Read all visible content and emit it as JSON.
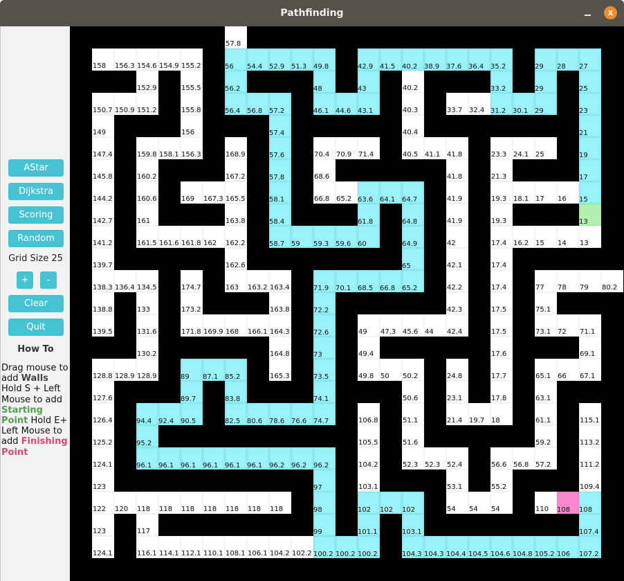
{
  "window": {
    "title": "Pathfinding",
    "minimize_label": "_",
    "close_label": "x"
  },
  "sidebar": {
    "buttons": {
      "astar": "AStar",
      "dijkstra": "Dijkstra",
      "scoring": "Scoring",
      "random": "Random",
      "plus": "+",
      "minus": "-",
      "clear": "Clear",
      "quit": "Quit"
    },
    "grid_size_label": "Grid Size 25",
    "howto_title": "How To",
    "howto": {
      "t1": "Drag mouse to add ",
      "walls": "Walls",
      "t2": " Hold S + Left Mouse to add ",
      "starting_point": "Starting Point",
      "t3": " Hold  E+ Left Mouse to add ",
      "finishing_point": "Finishing Point"
    }
  },
  "grid": {
    "size": 25,
    "legend": {
      "W": "wall",
      "o": "open",
      "p": "path",
      "s": "start",
      "e": "end"
    },
    "colors": {
      "wall": "#000000",
      "open": "#ffffff",
      "path": "#99f3f8",
      "start": "#b3efb0",
      "end": "#f888cf"
    },
    "rows": [
      [
        "W",
        "W",
        "W",
        "W",
        "W",
        "W",
        "W",
        "o:57.8",
        "W",
        "W",
        "W",
        "W",
        "W",
        "W",
        "W",
        "W",
        "W",
        "W",
        "W",
        "W",
        "W",
        "W",
        "W",
        "W",
        "W"
      ],
      [
        "W",
        "o:158",
        "o:156.3",
        "o:154.6",
        "o:154.9",
        "o:155.2",
        "W",
        "p:56",
        "p:54.4",
        "p:52.9",
        "p:51.3",
        "p:49.8",
        "W",
        "p:42.9",
        "p:41.5",
        "p:40.2",
        "p:38.9",
        "p:37.6",
        "p:36.4",
        "p:35.2",
        "W",
        "p:29",
        "p:28",
        "p:27",
        "W"
      ],
      [
        "W",
        "W",
        "W",
        "o:152.9",
        "W",
        "o:155.5",
        "W",
        "p:56.2",
        "W",
        "W",
        "W",
        "p:48",
        "W",
        "p:43",
        "W",
        "o:40.2",
        "W",
        "W",
        "W",
        "p:33.2",
        "W",
        "p:29",
        "W",
        "p:25",
        "W"
      ],
      [
        "W",
        "o:150.7",
        "o:150.9",
        "o:151.2",
        "W",
        "o:155.8",
        "W",
        "p:56.4",
        "p:56.8",
        "p:57.2",
        "W",
        "p:46.1",
        "p:44.6",
        "p:43.1",
        "W",
        "o:40.3",
        "W",
        "o:33.7",
        "o:32.4",
        "p:31.2",
        "p:30.1",
        "p:29",
        "W",
        "p:23",
        "W"
      ],
      [
        "W",
        "o:149",
        "W",
        "W",
        "W",
        "o:156",
        "W",
        "W",
        "W",
        "p:57.4",
        "W",
        "W",
        "W",
        "W",
        "W",
        "o:40.4",
        "W",
        "W",
        "W",
        "W",
        "W",
        "W",
        "W",
        "p:21",
        "W"
      ],
      [
        "W",
        "o:147.4",
        "W",
        "o:159.8",
        "o:158.1",
        "o:156.3",
        "W",
        "o:168.9",
        "W",
        "p:57.6",
        "W",
        "o:70.4",
        "o:70.9",
        "o:71.4",
        "W",
        "o:40.5",
        "o:41.1",
        "o:41.8",
        "W",
        "o:23.3",
        "o:24.1",
        "o:25",
        "W",
        "p:19",
        "W"
      ],
      [
        "W",
        "o:145.8",
        "W",
        "o:160.2",
        "W",
        "W",
        "W",
        "o:167.2",
        "W",
        "p:57.8",
        "W",
        "o:68.6",
        "W",
        "W",
        "W",
        "W",
        "W",
        "o:41.8",
        "W",
        "o:21.3",
        "W",
        "W",
        "W",
        "p:17",
        "W"
      ],
      [
        "W",
        "o:144.2",
        "W",
        "o:160.6",
        "W",
        "o:169",
        "o:167.3",
        "o:165.5",
        "W",
        "p:58.1",
        "W",
        "o:66.8",
        "o:65.2",
        "p:63.6",
        "p:64.1",
        "p:64.7",
        "W",
        "o:41.9",
        "W",
        "o:19.3",
        "o:18.1",
        "o:17",
        "o:16",
        "p:15",
        "W"
      ],
      [
        "W",
        "o:142.7",
        "W",
        "o:161",
        "W",
        "W",
        "W",
        "o:163.8",
        "W",
        "p:58.4",
        "W",
        "W",
        "W",
        "p:61.8",
        "W",
        "p:64.8",
        "W",
        "o:41.9",
        "W",
        "o:19.3",
        "W",
        "W",
        "W",
        "s:13",
        "W"
      ],
      [
        "W",
        "o:141.2",
        "W",
        "o:161.5",
        "o:161.6",
        "o:161.8",
        "o:162",
        "o:162.2",
        "W",
        "p:58.7",
        "p:59",
        "p:59.3",
        "p:59.6",
        "p:60",
        "W",
        "p:64.9",
        "W",
        "o:42",
        "W",
        "o:17.4",
        "o:16.2",
        "o:15",
        "o:14",
        "o:13",
        "W"
      ],
      [
        "W",
        "o:139.7",
        "W",
        "W",
        "W",
        "W",
        "W",
        "o:162.6",
        "W",
        "W",
        "W",
        "W",
        "W",
        "W",
        "W",
        "p:65",
        "W",
        "o:42.1",
        "W",
        "o:17.4",
        "W",
        "W",
        "W",
        "W",
        "W"
      ],
      [
        "W",
        "o:138.3",
        "o:136.4",
        "o:134.5",
        "W",
        "o:174.7",
        "W",
        "o:163",
        "o:163.2",
        "o:163.4",
        "W",
        "p:71.9",
        "p:70.1",
        "p:68.5",
        "p:66.8",
        "p:65.2",
        "W",
        "o:42.2",
        "W",
        "o:17.4",
        "W",
        "o:77",
        "o:78",
        "o:79",
        "o:80.2"
      ],
      [
        "W",
        "o:138.8",
        "W",
        "o:133",
        "W",
        "o:173.2",
        "W",
        "W",
        "W",
        "o:163.8",
        "W",
        "p:72.2",
        "W",
        "W",
        "W",
        "W",
        "W",
        "o:42.3",
        "W",
        "o:17.5",
        "W",
        "o:75.1",
        "W",
        "W",
        "W"
      ],
      [
        "W",
        "o:139.5",
        "W",
        "o:131.6",
        "W",
        "o:171.8",
        "o:169.9",
        "o:168",
        "o:166.1",
        "o:164.3",
        "W",
        "p:72.6",
        "W",
        "o:49",
        "o:47.3",
        "o:45.6",
        "o:44",
        "o:42.4",
        "W",
        "o:17.5",
        "W",
        "o:73.1",
        "o:72",
        "o:71.1",
        "W"
      ],
      [
        "W",
        "W",
        "W",
        "o:130.2",
        "W",
        "W",
        "W",
        "W",
        "W",
        "o:164.8",
        "W",
        "p:73",
        "W",
        "o:49.4",
        "W",
        "W",
        "W",
        "W",
        "W",
        "o:17.6",
        "W",
        "W",
        "W",
        "o:69.1",
        "W"
      ],
      [
        "W",
        "o:128.8",
        "o:128.9",
        "o:128.9",
        "W",
        "p:89",
        "p:87.1",
        "p:85.2",
        "W",
        "o:165.3",
        "W",
        "p:73.5",
        "W",
        "o:49.8",
        "o:50",
        "o:50.2",
        "W",
        "o:24.8",
        "W",
        "o:17.7",
        "W",
        "o:65.1",
        "o:66",
        "o:67.1",
        "W"
      ],
      [
        "W",
        "o:127.6",
        "W",
        "W",
        "W",
        "p:89.7",
        "W",
        "p:83.8",
        "W",
        "W",
        "W",
        "p:74.1",
        "W",
        "W",
        "W",
        "o:50.6",
        "W",
        "o:23.1",
        "W",
        "o:17.8",
        "W",
        "o:63.1",
        "W",
        "W",
        "W"
      ],
      [
        "W",
        "o:126.4",
        "W",
        "p:94.4",
        "p:92.4",
        "p:90.5",
        "W",
        "p:82.5",
        "p:80.6",
        "p:78.6",
        "p:76.6",
        "p:74.7",
        "W",
        "o:106.8",
        "W",
        "o:51.1",
        "W",
        "o:21.4",
        "o:19.7",
        "o:18",
        "W",
        "o:61.1",
        "W",
        "o:115.1",
        "W"
      ],
      [
        "W",
        "o:125.2",
        "W",
        "p:95.2",
        "W",
        "W",
        "W",
        "W",
        "W",
        "W",
        "W",
        "W",
        "W",
        "o:105.5",
        "W",
        "o:51.6",
        "W",
        "W",
        "W",
        "W",
        "W",
        "o:59.2",
        "W",
        "o:113.2",
        "W"
      ],
      [
        "W",
        "o:124.1",
        "W",
        "p:96.1",
        "p:96.1",
        "p:96.1",
        "p:96.1",
        "p:96.1",
        "p:96.1",
        "p:96.2",
        "p:96.2",
        "p:96.2",
        "W",
        "o:104.2",
        "W",
        "o:52.3",
        "o:52.3",
        "o:52.4",
        "W",
        "o:56.6",
        "o:56.8",
        "o:57.2",
        "W",
        "o:111.2",
        "W"
      ],
      [
        "W",
        "o:123",
        "W",
        "W",
        "W",
        "W",
        "W",
        "W",
        "W",
        "W",
        "W",
        "p:97",
        "W",
        "o:103.1",
        "W",
        "W",
        "W",
        "o:53.1",
        "W",
        "o:55.2",
        "W",
        "W",
        "W",
        "o:109.4",
        "W"
      ],
      [
        "W",
        "o:122",
        "o:120",
        "o:118",
        "o:118",
        "o:118",
        "o:118",
        "o:118",
        "o:118",
        "o:118",
        "W",
        "p:98",
        "W",
        "p:102",
        "p:102",
        "p:102",
        "W",
        "o:54",
        "o:54",
        "o:54",
        "W",
        "o:110",
        "e:108",
        "p:108",
        "W"
      ],
      [
        "W",
        "o:123",
        "W",
        "o:117",
        "W",
        "W",
        "W",
        "W",
        "W",
        "W",
        "W",
        "p:99",
        "W",
        "p:101.1",
        "W",
        "p:103.1",
        "W",
        "W",
        "W",
        "W",
        "W",
        "W",
        "W",
        "p:107.4",
        "W"
      ],
      [
        "W",
        "o:124.1",
        "W",
        "o:116.1",
        "o:114.1",
        "o:112.1",
        "o:110.1",
        "o:108.1",
        "o:106.1",
        "o:104.2",
        "o:102.2",
        "p:100.2",
        "p:100.2",
        "p:100.2",
        "W",
        "p:104.3",
        "p:104.3",
        "p:104.4",
        "p:104.5",
        "p:104.6",
        "p:104.8",
        "p:105.2",
        "p:106",
        "p:107.2",
        "W"
      ],
      [
        "W",
        "W",
        "W",
        "W",
        "W",
        "W",
        "W",
        "W",
        "W",
        "W",
        "W",
        "W",
        "W",
        "W",
        "W",
        "W",
        "W",
        "W",
        "W",
        "W",
        "W",
        "W",
        "W",
        "W",
        "W"
      ]
    ]
  }
}
